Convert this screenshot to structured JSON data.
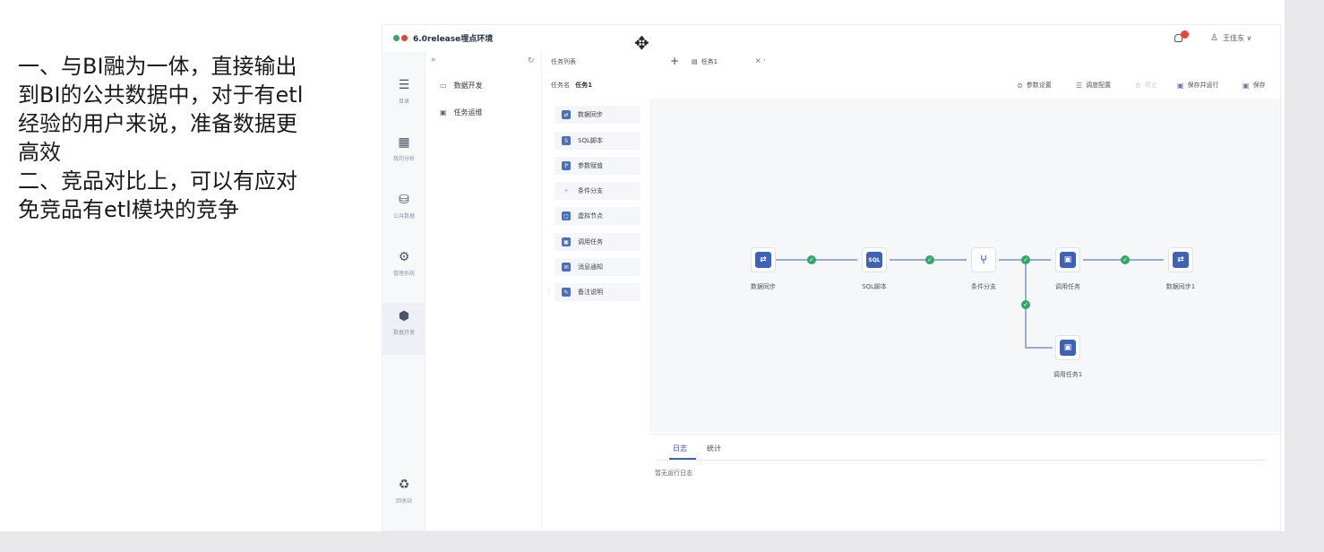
{
  "slide": {
    "lines": [
      "一、与BI融为一体，直接输出",
      "到BI的公共数据中，对于有etl",
      "经验的用户来说，准备数据更",
      "高效",
      "二、竞品对比上，可以有应对",
      "免竞品有etl模块的竞争"
    ]
  },
  "app": {
    "env_name": "6.0release埋点环境",
    "user_name": "王佳东 ∨",
    "brand_colors": [
      "#2ea866",
      "#e0452f"
    ],
    "rail": [
      {
        "label": "目录",
        "icon": "list-icon"
      },
      {
        "label": "我的分析",
        "icon": "dashboard-icon"
      },
      {
        "label": "公共数据",
        "icon": "database-icon"
      },
      {
        "label": "管理系统",
        "icon": "gear-icon"
      },
      {
        "label": "数据开发",
        "icon": "cube-icon",
        "active": true
      },
      {
        "label": "回收站",
        "icon": "recycle-icon"
      }
    ],
    "nav_tree": [
      {
        "label": "数据开发"
      },
      {
        "label": "任务运维"
      }
    ],
    "tabs": {
      "task_list": "任务列表",
      "add": "+",
      "open_tab": "任务1",
      "close": "× ·"
    },
    "task_row": {
      "label": "任务名",
      "value": "任务1"
    },
    "toolbar": {
      "param_settings": "参数设置",
      "schedule_config": "调度配置",
      "stop": "停止",
      "save_and_run": "保存并运行",
      "save": "保存"
    },
    "palette": [
      {
        "label": "数据同步"
      },
      {
        "label": "SQL脚本"
      },
      {
        "label": "参数赋值"
      },
      {
        "label": "条件分支"
      },
      {
        "label": "虚拟节点"
      },
      {
        "label": "调用任务"
      },
      {
        "label": "消息通知"
      },
      {
        "label": "备注说明"
      }
    ],
    "nodes": [
      {
        "label": "数据同步",
        "glyph": "⇄"
      },
      {
        "label": "SQL脚本",
        "glyph": "SQL"
      },
      {
        "label": "条件分支",
        "glyph": "⑂"
      },
      {
        "label": "调用任务",
        "glyph": "▣"
      },
      {
        "label": "数据同步1",
        "glyph": "⇄"
      },
      {
        "label": "调用任务1",
        "glyph": "▣"
      }
    ],
    "bottom_tabs": {
      "log": "日志",
      "stats": "统计"
    },
    "log_empty": "暂无运行日志",
    "accent_color": "#3f63b4",
    "success_color": "#2ea866"
  }
}
